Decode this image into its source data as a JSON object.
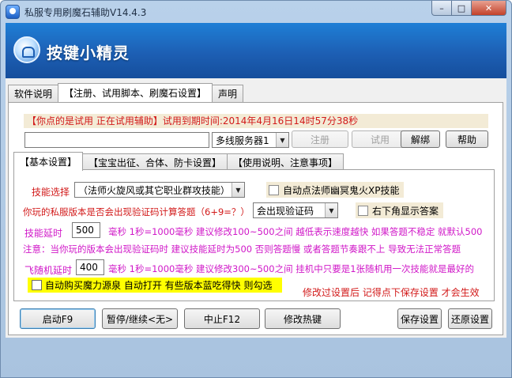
{
  "window": {
    "title": "私服专用刷魔石辅助V14.4.3",
    "min_glyph": "–",
    "max_glyph": "□",
    "close_glyph": "✕"
  },
  "banner": {
    "text": "按键小精灵"
  },
  "main_tabs": [
    {
      "label": "软件说明",
      "active": false
    },
    {
      "label": "【注册、试用脚本、刷魔石设置】",
      "active": true
    },
    {
      "label": "声明",
      "active": false
    }
  ],
  "notice": "【你点的是试用 正在试用辅助】试用到期时间:2014年4月16日14时57分38秒",
  "register": {
    "code_value": "",
    "server_select": "多线服务器1",
    "register_btn": "注册",
    "trial_btn": "试用",
    "unbind_btn": "解绑",
    "help_btn": "帮助"
  },
  "inner_tabs": [
    {
      "label": "【基本设置】",
      "active": true
    },
    {
      "label": "【宝宝出征、合体、防卡设置】",
      "active": false
    },
    {
      "label": "【使用说明、注意事项】",
      "active": false
    }
  ],
  "basic": {
    "skill_label": "技能选择",
    "skill_value": "（法师火旋风或其它职业群攻技能）",
    "auto_skill_label": "自动点法师幽冥鬼火XP技能",
    "captcha_question": "你玩的私服版本是否会出现验证码计算答题（6+9=？）",
    "captcha_value": "会出现验证码",
    "corner_answer_label": "右下角显示答案",
    "delay_label": "技能延时",
    "delay_value": "500",
    "delay_hint": "毫秒 1秒=1000毫秒 建议修改100~500之间 越低表示速度越快 如果答题不稳定 就默认500",
    "warning": "注意：当你玩的版本会出现验证码时 建议技能延时为500 否则答题慢 或者答题节奏跟不上 导致无法正常答题",
    "fly_label": "飞随机延时",
    "fly_value": "400",
    "fly_hint": "毫秒 1秒=1000毫秒 建议修改300~500之间 挂机中只要是1张随机用一次技能就是最好的",
    "auto_buy_label": "自动购买魔力源泉 自动打开 有些版本蓝吃得快 则勾选",
    "save_hint": "修改过设置后 记得点下保存设置 才会生效"
  },
  "actions": {
    "start": "启动F9",
    "pause": "暂停/继续<无>",
    "stop": "中止F12",
    "hotkey": "修改热键",
    "save": "保存设置",
    "restore": "还原设置"
  }
}
